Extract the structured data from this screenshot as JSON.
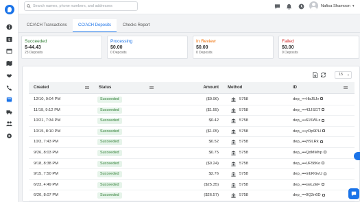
{
  "search": {
    "placeholder": "Search names, phone numbers, and addresses"
  },
  "user": {
    "name": "Nafisa Shamoon"
  },
  "tabs": [
    {
      "label": "CC/ACH Transactions"
    },
    {
      "label": "CC/ACH Deposits"
    },
    {
      "label": "Checks Report"
    }
  ],
  "summary": [
    {
      "title": "Succeeded",
      "amount": "$-44.43",
      "count": "23 Deposits",
      "color": "#2e7d32"
    },
    {
      "title": "Processing",
      "amount": "$0.00",
      "count": "0 Deposits",
      "color": "#1a73e8"
    },
    {
      "title": "In Review",
      "amount": "$0.00",
      "count": "0 Deposits",
      "color": "#ef6c00"
    },
    {
      "title": "Failed",
      "amount": "$0.00",
      "count": "0 Deposits",
      "color": "#d32f2f"
    }
  ],
  "per_page": "15",
  "table": {
    "headers": {
      "created": "Created",
      "status": "Status",
      "amount": "Amount",
      "method": "Method",
      "id": "ID"
    },
    "rows": [
      {
        "created": "12/10, 9:04 PM",
        "status": "Succeeded",
        "amount": "($0.96)",
        "method": "5758",
        "id": "dep_•••HbJ5Jv"
      },
      {
        "created": "11/19, 9:12 PM",
        "status": "Succeeded",
        "amount": "($1.55)",
        "method": "5758",
        "id": "dep_•••43JSGT"
      },
      {
        "created": "10/21, 7:34 PM",
        "status": "Succeeded",
        "amount": "$0.42",
        "method": "5758",
        "id": "dep_•••615WLz"
      },
      {
        "created": "10/15, 8:10 PM",
        "status": "Succeeded",
        "amount": "($1.05)",
        "method": "5758",
        "id": "dep_•••yOp9PH"
      },
      {
        "created": "10/3, 7:43 PM",
        "status": "Succeeded",
        "amount": "$0.52",
        "method": "5758",
        "id": "dep_•••jY9LRk"
      },
      {
        "created": "9/26, 8:03 PM",
        "status": "Succeeded",
        "amount": "$0.75",
        "method": "5758",
        "id": "dep_•••QdMMhp"
      },
      {
        "created": "9/18, 8:38 PM",
        "status": "Succeeded",
        "amount": "($0.24)",
        "method": "5758",
        "id": "dep_•••UF58Ko"
      },
      {
        "created": "9/15, 7:50 PM",
        "status": "Succeeded",
        "amount": "$2.76",
        "method": "5758",
        "id": "dep_•••mbRGvU"
      },
      {
        "created": "6/23, 4:49 PM",
        "status": "Succeeded",
        "amount": "($25.35)",
        "method": "5758",
        "id": "dep_•••swLzEF"
      },
      {
        "created": "6/20, 8:07 PM",
        "status": "Succeeded",
        "amount": "($26.57)",
        "method": "5758",
        "id": "dep_•••0Q2n6D"
      }
    ]
  }
}
